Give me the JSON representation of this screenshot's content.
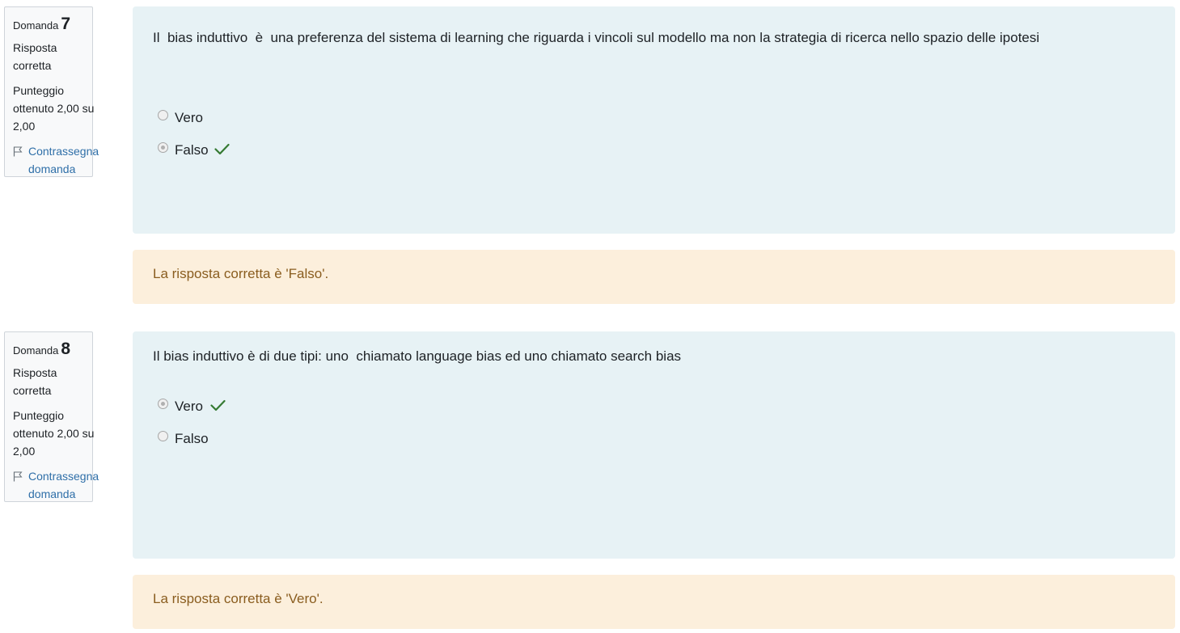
{
  "questions": [
    {
      "label": "Domanda",
      "number": "7",
      "state": "Risposta corretta",
      "grade": "Punteggio ottenuto 2,00 su 2,00",
      "flag": "Contrassegna domanda",
      "text": "Il  bias induttivo  è  una preferenza del sistema di learning che riguarda i vincoli sul modello ma non la strategia di ricerca nello spazio delle ipotesi",
      "options": [
        {
          "label": "Vero",
          "selected": false,
          "correct_mark": false
        },
        {
          "label": "Falso",
          "selected": true,
          "correct_mark": true
        }
      ],
      "feedback": "La risposta corretta è 'Falso'."
    },
    {
      "label": "Domanda",
      "number": "8",
      "state": "Risposta corretta",
      "grade": "Punteggio ottenuto 2,00 su 2,00",
      "flag": "Contrassegna domanda",
      "text": "Il bias induttivo è di due tipi: uno  chiamato language bias ed uno chiamato search bias",
      "options": [
        {
          "label": "Vero",
          "selected": true,
          "correct_mark": true
        },
        {
          "label": "Falso",
          "selected": false,
          "correct_mark": false
        }
      ],
      "feedback": "La risposta corretta è 'Vero'."
    }
  ],
  "colors": {
    "info_bg": "#f8f9fa",
    "formulation_bg": "#e7f2f5",
    "feedback_bg": "#fcefdc",
    "feedback_text": "#8a5d1f",
    "link": "#2f6fa8",
    "tick": "#357a32"
  },
  "icons": {
    "flag": "flag-icon",
    "correct": "check-icon"
  }
}
